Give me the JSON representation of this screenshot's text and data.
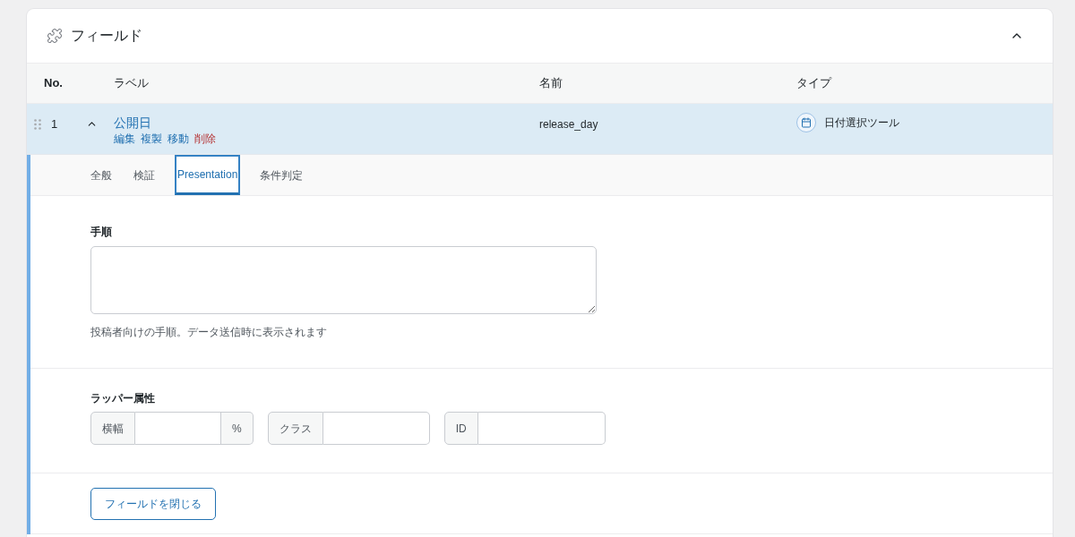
{
  "panel": {
    "title": "フィールド",
    "expanded": true
  },
  "table": {
    "columns": [
      "No.",
      "ラベル",
      "名前",
      "タイプ"
    ],
    "rows": [
      {
        "number": "1",
        "label": "公開日",
        "expanded": true,
        "actions": [
          {
            "label": "編集",
            "kind": "link"
          },
          {
            "label": "複製",
            "kind": "link"
          },
          {
            "label": "移動",
            "kind": "link"
          },
          {
            "label": "削除",
            "kind": "danger"
          }
        ],
        "name": "release_day",
        "type": "日付選択ツール"
      }
    ]
  },
  "settings": {
    "tabs": [
      {
        "label": "全般",
        "selected": false
      },
      {
        "label": "検証",
        "selected": false
      },
      {
        "label": "Presentation",
        "selected": true
      },
      {
        "label": "条件判定",
        "selected": false
      }
    ],
    "instructions": {
      "label": "手順",
      "help": "投稿者向けの手順。データ送信時に表示されます"
    },
    "wrapper": {
      "label": "ラッパー属性",
      "fields": [
        {
          "prefix": "横幅",
          "suffix": "%"
        },
        {
          "prefix": "クラス"
        },
        {
          "prefix": "ID"
        }
      ]
    },
    "close_button": "フィールドを閉じる"
  }
}
